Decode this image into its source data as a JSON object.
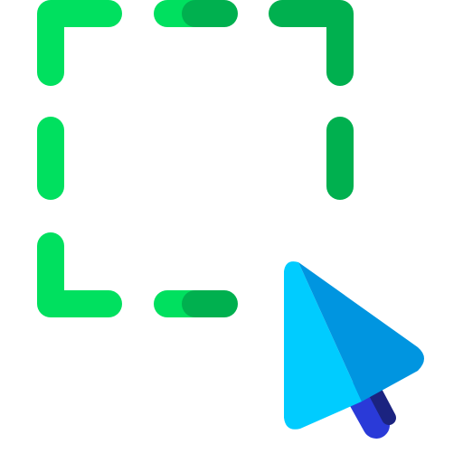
{
  "icon": {
    "name": "select-area-icon",
    "colors": {
      "selection_light": "#00e05f",
      "selection_dark": "#00b04f",
      "cursor_light": "#00ccff",
      "cursor_dark": "#0095e0",
      "handle_light": "#2a3ad8",
      "handle_dark": "#1b2380"
    }
  }
}
